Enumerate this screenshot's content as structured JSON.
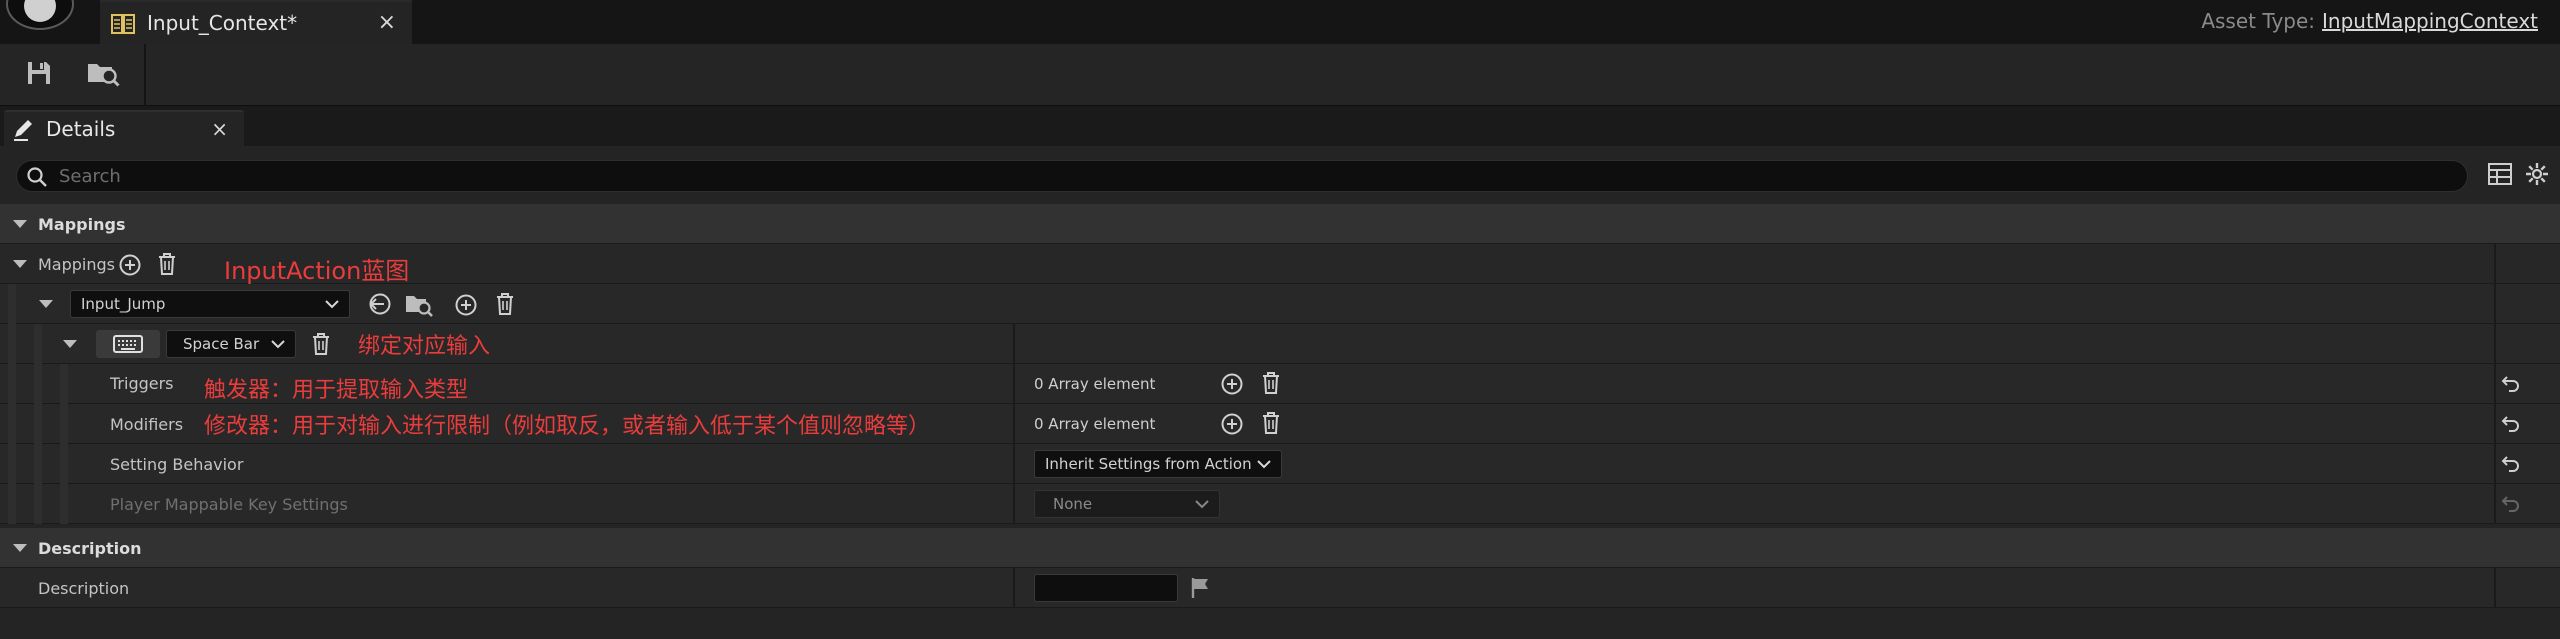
{
  "window": {
    "doc_tab_title": "Input_Context*",
    "doc_tab_close": "×",
    "asset_type_label": "Asset Type:",
    "asset_type_value": "InputMappingContext"
  },
  "toolbar": {
    "buttons": [
      {
        "name": "save-icon"
      },
      {
        "name": "browse-to-asset-icon"
      }
    ]
  },
  "details_tab": {
    "label": "Details",
    "close": "×"
  },
  "search": {
    "placeholder": "Search"
  },
  "sections": {
    "mappings_category": "Mappings",
    "mappings_array_label": "Mappings",
    "input_action_value": "Input_Jump",
    "key_value": "Space Bar",
    "triggers_label": "Triggers",
    "triggers_value": "0 Array element",
    "modifiers_label": "Modifiers",
    "modifiers_value": "0 Array element",
    "setting_behavior_label": "Setting Behavior",
    "setting_behavior_value": "Inherit Settings from Action",
    "player_mappable_label": "Player Mappable Key Settings",
    "player_mappable_value": "None",
    "description_category": "Description",
    "description_label": "Description",
    "description_value": ""
  },
  "annotations": {
    "input_action": "InputAction蓝图",
    "bind_key": "绑定对应输入",
    "triggers": "触发器：用于提取输入类型",
    "modifiers": "修改器：用于对输入进行限制（例如取反，或者输入低于某个值则忽略等）"
  },
  "colors": {
    "annotation": "#ea3c3c",
    "background": "#242424",
    "category_row": "#323232"
  }
}
